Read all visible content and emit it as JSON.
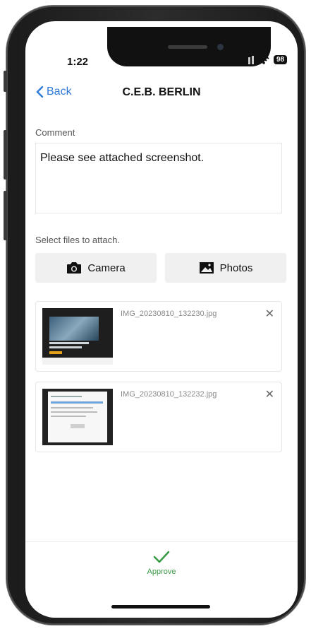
{
  "status": {
    "time": "1:22",
    "battery": "98"
  },
  "nav": {
    "back_label": "Back",
    "title": "C.E.B. BERLIN"
  },
  "comment": {
    "label": "Comment",
    "value": "Please see attached screenshot."
  },
  "attach": {
    "label": "Select files to attach.",
    "camera_label": "Camera",
    "photos_label": "Photos"
  },
  "files": [
    {
      "name": "IMG_20230810_132230.jpg"
    },
    {
      "name": "IMG_20230810_132232.jpg"
    }
  ],
  "footer": {
    "approve_label": "Approve"
  },
  "colors": {
    "accent": "#2f7ad9",
    "approve": "#3a9a45"
  }
}
